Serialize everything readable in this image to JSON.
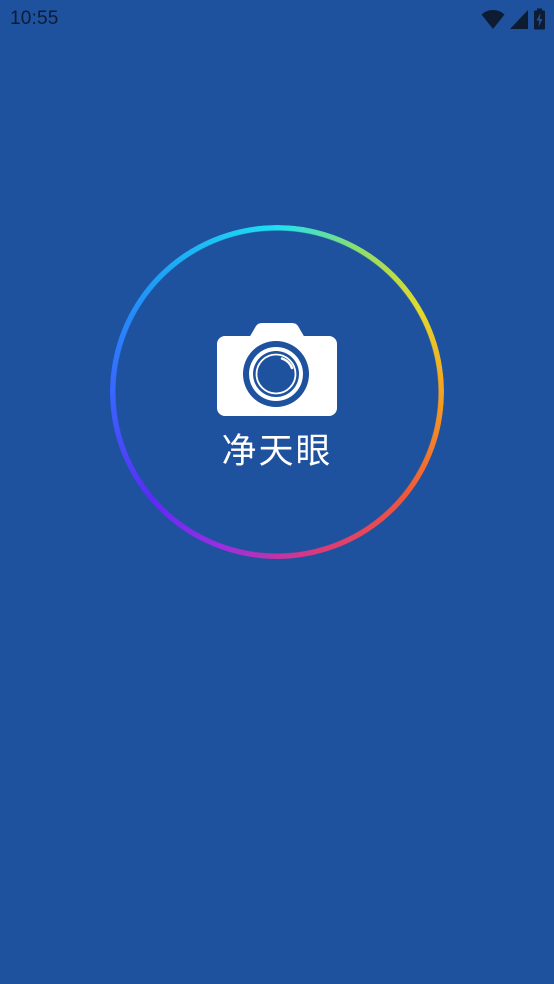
{
  "status_bar": {
    "time": "10:55",
    "icons": [
      "wifi-icon",
      "cell-signal-icon",
      "battery-charging-icon"
    ]
  },
  "splash": {
    "app_name": "净天眼",
    "logo_icon": "camera-icon"
  },
  "colors": {
    "background": "#1E519E",
    "text": "#FFFFFF",
    "status_text": "#0E1C33",
    "ring_gradient": [
      "#1EE0F2",
      "#E3D92C",
      "#F3A21F",
      "#F1553A",
      "#DC3A7A",
      "#9B2EE0",
      "#5B2CF5",
      "#1D9CF7"
    ]
  }
}
